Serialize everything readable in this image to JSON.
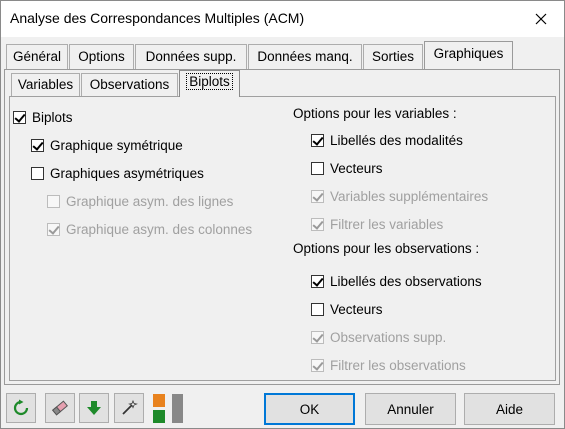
{
  "window": {
    "title": "Analyse des Correspondances Multiples (ACM)"
  },
  "tabs": [
    "Général",
    "Options",
    "Données supp.",
    "Données manq.",
    "Sorties",
    "Graphiques"
  ],
  "subtabs": [
    "Variables",
    "Observations",
    "Biplots"
  ],
  "left": {
    "biplots": "Biplots",
    "sym": "Graphique symétrique",
    "asym": "Graphiques asymétriques",
    "asym_rows": "Graphique asym. des lignes",
    "asym_cols": "Graphique asym. des colonnes"
  },
  "right": {
    "var_header": "Options pour les variables :",
    "var_labels": "Libellés des modalités",
    "var_vectors": "Vecteurs",
    "var_supp": "Variables supplémentaires",
    "var_filter": "Filtrer les variables",
    "obs_header": "Options pour les observations :",
    "obs_labels": "Libellés des observations",
    "obs_vectors": "Vecteurs",
    "obs_supp": "Observations supp.",
    "obs_filter": "Filtrer les observations"
  },
  "buttons": {
    "ok": "OK",
    "cancel": "Annuler",
    "help": "Aide"
  },
  "icons": [
    "reset-icon",
    "eraser-icon",
    "download-arrow-icon",
    "magic-wand-icon",
    "toggle-panel-icon"
  ],
  "colors": {
    "focus_border": "#0078d7",
    "arrow_green": "#1e8a2a",
    "panel_orange": "#e8821e"
  }
}
